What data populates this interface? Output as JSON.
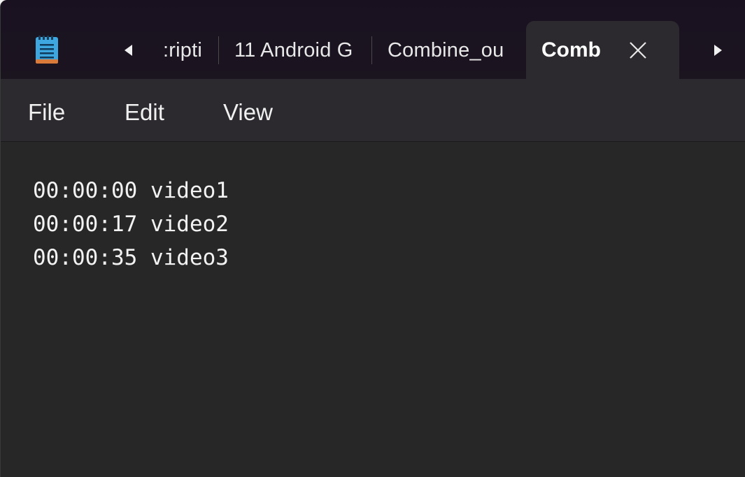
{
  "tabs": [
    {
      "label": ":ripti"
    },
    {
      "label": "11 Android G"
    },
    {
      "label": "Combine_ou"
    }
  ],
  "active_tab": {
    "label": "Comb"
  },
  "menu": {
    "file": "File",
    "edit": "Edit",
    "view": "View"
  },
  "editor": {
    "lines": [
      "00:00:00 video1",
      "00:00:17 video2",
      "00:00:35 video3"
    ]
  },
  "icons": {
    "app": "notepad-icon",
    "scroll_left": "triangle-left-icon",
    "scroll_right": "triangle-right-icon",
    "close": "close-icon"
  },
  "colors": {
    "titlebar": "#1a1120",
    "active_tab": "#2c2a2f",
    "editor_bg": "#272727",
    "text": "#f2f2f2",
    "icon_accent": "#4fb3e8"
  }
}
